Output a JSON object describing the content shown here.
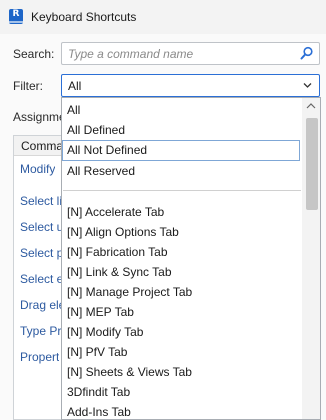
{
  "window": {
    "title": "Keyboard Shortcuts",
    "app_icon_letter": "R"
  },
  "search": {
    "label": "Search:",
    "placeholder": "Type a command name",
    "icon": "search-icon"
  },
  "filter": {
    "label": "Filter:",
    "selected": "All",
    "icon": "chevron-down-icon"
  },
  "assignments": {
    "label": "Assignme",
    "column_header": "Comma",
    "commands": [
      "Modify",
      "Select li",
      "Select u",
      "Select p",
      "Select e",
      "Drag ele",
      "Type Pr",
      "Propert"
    ]
  },
  "filter_dropdown": {
    "options_group1": [
      "All",
      "All Defined",
      "All Not Defined",
      "All Reserved"
    ],
    "hovered_option": "All Not Defined",
    "options_group2": [
      "[N] Accelerate Tab",
      "[N] Align Options Tab",
      "[N] Fabrication Tab",
      "[N] Link & Sync Tab",
      "[N] Manage Project Tab",
      "[N] MEP Tab",
      "[N] Modify Tab",
      "[N] PfV Tab",
      "[N] Sheets & Views Tab",
      "3Dfindit Tab",
      "Add-Ins Tab"
    ],
    "scroll_up_icon": "chevron-up-icon"
  },
  "colors": {
    "accent": "#2b6fd6",
    "app_icon": "#1e66c8",
    "command_link": "#2d5aa0"
  }
}
